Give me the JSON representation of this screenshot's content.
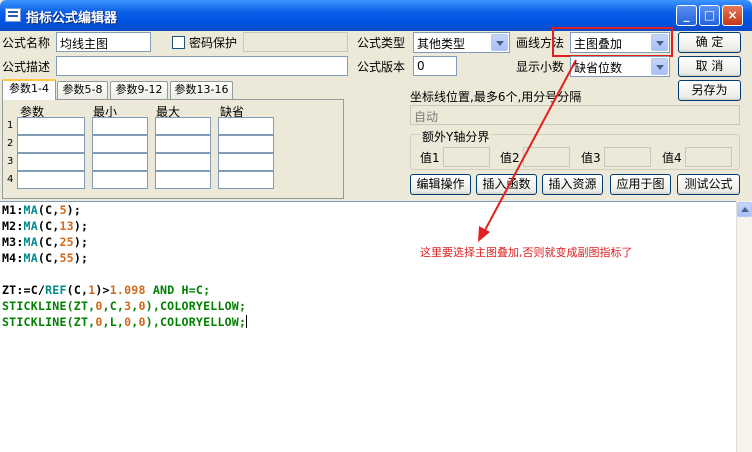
{
  "window": {
    "title": "指标公式编辑器",
    "controls": [
      "_",
      "□",
      "×"
    ]
  },
  "form": {
    "name_label": "公式名称",
    "name_value": "均线主图",
    "password_label": "密码保护",
    "type_label": "公式类型",
    "type_value": "其他类型",
    "draw_label": "画线方法",
    "draw_value": "主图叠加",
    "desc_label": "公式描述",
    "desc_value": "",
    "version_label": "公式版本",
    "version_value": "0",
    "decimals_label": "显示小数",
    "decimals_value": "缺省位数"
  },
  "buttons": {
    "ok": "确  定",
    "cancel": "取  消",
    "save_as": "另存为"
  },
  "tabs": [
    "参数1-4",
    "参数5-8",
    "参数9-12",
    "参数13-16"
  ],
  "params": {
    "headers": [
      "参数",
      "最小",
      "最大",
      "缺省"
    ],
    "rows": [
      "1",
      "2",
      "3",
      "4"
    ]
  },
  "axis": {
    "label": "坐标线位置,最多6个,用分号分隔",
    "value": "自动",
    "extra_y_label": "额外Y轴分界",
    "values": [
      "值1",
      "值2",
      "值3",
      "值4"
    ]
  },
  "actions": [
    "编辑操作",
    "插入函数",
    "插入资源",
    "应用于图",
    "测试公式"
  ],
  "code_lines": [
    [
      {
        "t": "M1:",
        "c": "k"
      },
      {
        "t": "MA",
        "c": "f"
      },
      {
        "t": "(C,",
        "c": "k"
      },
      {
        "t": "5",
        "c": "n"
      },
      {
        "t": ");",
        "c": "k"
      }
    ],
    [
      {
        "t": "M2:",
        "c": "k"
      },
      {
        "t": "MA",
        "c": "f"
      },
      {
        "t": "(C,",
        "c": "k"
      },
      {
        "t": "13",
        "c": "n"
      },
      {
        "t": ");",
        "c": "k"
      }
    ],
    [
      {
        "t": "M3:",
        "c": "k"
      },
      {
        "t": "MA",
        "c": "f"
      },
      {
        "t": "(C,",
        "c": "k"
      },
      {
        "t": "25",
        "c": "n"
      },
      {
        "t": ");",
        "c": "k"
      }
    ],
    [
      {
        "t": "M4:",
        "c": "k"
      },
      {
        "t": "MA",
        "c": "f"
      },
      {
        "t": "(C,",
        "c": "k"
      },
      {
        "t": "55",
        "c": "n"
      },
      {
        "t": ");",
        "c": "k"
      }
    ],
    [],
    [
      {
        "t": "ZT:=C/",
        "c": "k"
      },
      {
        "t": "REF",
        "c": "f"
      },
      {
        "t": "(C,",
        "c": "k"
      },
      {
        "t": "1",
        "c": "n"
      },
      {
        "t": ")>",
        "c": "k"
      },
      {
        "t": "1.098",
        "c": "n"
      },
      {
        "t": " AND H=C;",
        "c": "g"
      }
    ],
    [
      {
        "t": "STICKLINE(ZT,",
        "c": "g"
      },
      {
        "t": "0",
        "c": "n"
      },
      {
        "t": ",C,",
        "c": "g"
      },
      {
        "t": "3",
        "c": "n"
      },
      {
        "t": ",",
        "c": "g"
      },
      {
        "t": "0",
        "c": "n"
      },
      {
        "t": "),COLORYELLOW;",
        "c": "g"
      }
    ],
    [
      {
        "t": "STICKLINE(ZT,",
        "c": "g"
      },
      {
        "t": "0",
        "c": "n"
      },
      {
        "t": ",L,",
        "c": "g"
      },
      {
        "t": "0",
        "c": "n"
      },
      {
        "t": ",",
        "c": "g"
      },
      {
        "t": "0",
        "c": "n"
      },
      {
        "t": "),COLORYELLOW;",
        "c": "g"
      }
    ]
  ],
  "annotation": "这里要选择主图叠加,否则就变成副图指标了",
  "colors": {
    "annotation": "#E02020",
    "highlight_box": "#E02020",
    "title_bar": "#0A5EE8"
  }
}
